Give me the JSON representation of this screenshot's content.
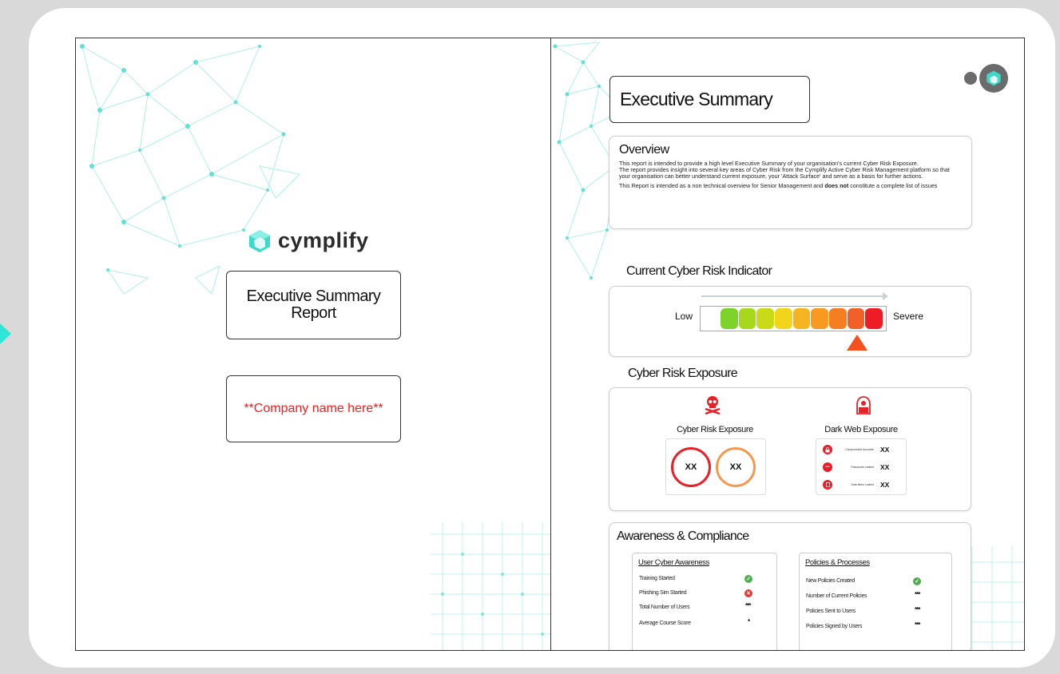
{
  "left_page": {
    "brand_name": "cymplify",
    "report_title": "Executive Summary Report",
    "company_placeholder": "**Company name here**"
  },
  "right_page": {
    "title": "Executive Summary",
    "overview": {
      "heading": "Overview",
      "para1": "This report is intended to provide a high level Executive Summary of your organisation's current Cyber Risk Exposure.",
      "para2": "The report provides insight into several key areas of Cyber Risk from the Cymplify Active Cyber Risk Management platform so that your organisation can better understand current exposure, your 'Attack Surface' and serve as a basis for further actions.",
      "para3_start": "This Report is intended as a non technical overview for Senior Management and ",
      "para3_bold": "does not",
      "para3_end": " constitute a complete list of issues"
    },
    "risk_indicator": {
      "heading": "Current Cyber Risk Indicator",
      "low_label": "Low",
      "high_label": "Severe",
      "level_fraction": 0.85,
      "segment_colors": [
        "#7cd32a",
        "#a8d81c",
        "#c8db16",
        "#f2d51a",
        "#f4b520",
        "#f89a1f",
        "#f57e22",
        "#f2602a",
        "#ee1c25"
      ]
    },
    "exposure": {
      "heading": "Cyber Risk Exposure",
      "cyber": {
        "label": "Cyber Risk Exposure",
        "icon": "skull-crossbones-icon",
        "value1": "XX",
        "value2": "XX",
        "ring1_color": "#e82127",
        "ring2_color": "#f39a52"
      },
      "dark_web": {
        "label": "Dark Web Exposure",
        "icon": "hacker-icon",
        "rows": [
          {
            "label": "Compromised Accounts",
            "value": "XX",
            "icon": "lock-icon"
          },
          {
            "label": "Passwords Leaked",
            "value": "XX",
            "icon": "password-icon"
          },
          {
            "label": "Data Items Leaked",
            "value": "XX",
            "icon": "document-icon"
          }
        ]
      }
    },
    "awareness": {
      "heading": "Awareness & Compliance",
      "user_panel": {
        "heading": "User Cyber Awareness",
        "rows": [
          {
            "label": "Training Started",
            "status": "ok"
          },
          {
            "label": "Phishing Sim Started",
            "status": "bad"
          },
          {
            "label": "Total Number of Users",
            "value": "***"
          },
          {
            "label": "Average Course Score",
            "value": "*"
          }
        ]
      },
      "policy_panel": {
        "heading": "Policies & Processes",
        "rows": [
          {
            "label": "New Policies Created",
            "status": "ok"
          },
          {
            "label": "Number of Current Policies",
            "value": "***"
          },
          {
            "label": "Policies Sent to Users",
            "value": "***"
          },
          {
            "label": "Policies Signed by Users",
            "value": "***"
          }
        ]
      }
    }
  }
}
